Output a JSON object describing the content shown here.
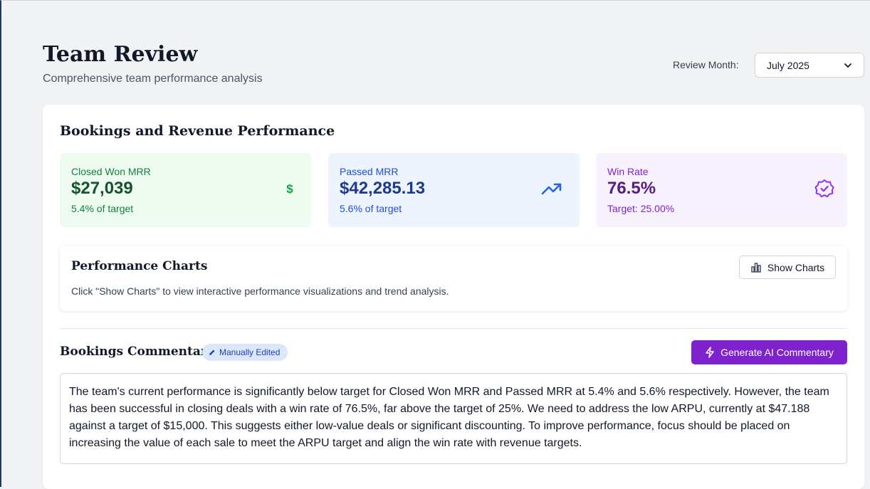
{
  "page": {
    "title": "Team Review",
    "subtitle": "Comprehensive team performance analysis",
    "month_label": "Review Month:",
    "month_value": "July 2025"
  },
  "bookings": {
    "title": "Bookings and Revenue Performance",
    "metrics": [
      {
        "label": "Closed Won MRR",
        "value": "$27,039",
        "sub": "5.4% of target",
        "icon": "dollar-icon",
        "color": "#16a34a"
      },
      {
        "label": "Passed MRR",
        "value": "$42,285.13",
        "sub": "5.6% of target",
        "icon": "trending-up-icon",
        "color": "#2563eb"
      },
      {
        "label": "Win Rate",
        "value": "76.5%",
        "sub": "Target: 25.00%",
        "icon": "badge-check-icon",
        "color": "#9333ea"
      }
    ]
  },
  "charts": {
    "title": "Performance Charts",
    "description": "Click \"Show Charts\" to view interactive performance visualizations and trend analysis.",
    "button_label": "Show Charts"
  },
  "commentary": {
    "title": "Bookings Commentary",
    "badge": "Manually Edited",
    "button_label": "Generate AI Commentary",
    "text": "The team's current performance is significantly below target for Closed Won MRR and Passed MRR at 5.4% and 5.6% respectively. However, the team has been successful in closing deals with a win rate of 76.5%, far above the target of 25%. We need to address the low ARPU, currently at $47.188 against a target of $15,000. This suggests either low-value deals or significant discounting. To improve performance, focus should be placed on increasing the value of each sale to meet the ARPU target and align the win rate with revenue targets."
  },
  "colors": {
    "accent": "#7e22ce",
    "green": "#16a34a",
    "blue": "#2563eb",
    "purple": "#9333ea"
  }
}
